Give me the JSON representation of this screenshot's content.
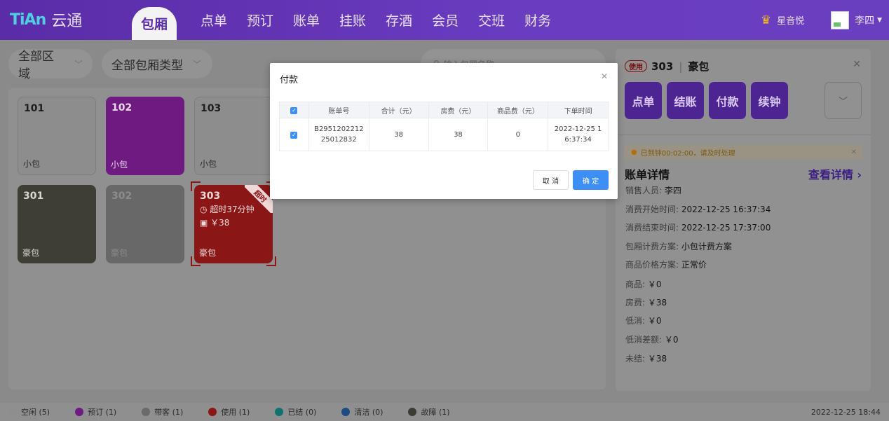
{
  "header": {
    "logo_mark": "TiAn",
    "logo_text": "云通",
    "nav": [
      "包厢",
      "点单",
      "预订",
      "账单",
      "挂账",
      "存酒",
      "会员",
      "交班",
      "财务"
    ],
    "store_name": "星音悦",
    "user_name": "李四"
  },
  "filters": {
    "area": "全部区域",
    "room_type": "全部包厢类型",
    "search_placeholder": "输入包厢名称"
  },
  "rooms": [
    {
      "num": "101",
      "type": "小包",
      "status": "idle"
    },
    {
      "num": "102",
      "type": "小包",
      "status": "reserved"
    },
    {
      "num": "103",
      "type": "小包",
      "status": "idle"
    },
    {
      "num": "301",
      "type": "豪包",
      "status": "fault"
    },
    {
      "num": "302",
      "type": "豪包",
      "status": "cleaning"
    },
    {
      "num": "303",
      "type": "豪包",
      "status": "using",
      "timeout_text": "超时37分钟",
      "amount_text": "￥38",
      "ribbon": "超时"
    }
  ],
  "detail": {
    "status": "使用",
    "room": "303",
    "room_type": "豪包",
    "actions": [
      "点单",
      "结账",
      "付款",
      "续钟"
    ],
    "warning": "已到钟00:02:00，请及时处理",
    "bill_title": "账单详情",
    "view_detail": "查看详情",
    "rows": [
      {
        "k": "销售人员:",
        "v": "李四"
      },
      {
        "k": "消费开始时间:",
        "v": "2022-12-25 16:37:34"
      },
      {
        "k": "消费结束时间:",
        "v": "2022-12-25 17:37:00"
      },
      {
        "k": "包厢计费方案:",
        "v": "小包计费方案"
      },
      {
        "k": "商品价格方案:",
        "v": "正常价"
      },
      {
        "k": "商品:",
        "v": "￥0"
      },
      {
        "k": "房费:",
        "v": "￥38"
      },
      {
        "k": "低消:",
        "v": "￥0"
      },
      {
        "k": "低消差额:",
        "v": "￥0"
      },
      {
        "k": "未结:",
        "v": "￥38"
      }
    ]
  },
  "legend": [
    {
      "label": "空闲 (5)",
      "color": "#8e8e8e"
    },
    {
      "label": "预订 (1)",
      "color": "#6e1a80"
    },
    {
      "label": "带客 (1)",
      "color": "#6a6a6a"
    },
    {
      "label": "使用 (1)",
      "color": "#8a1616"
    },
    {
      "label": "已结 (0)",
      "color": "#127070"
    },
    {
      "label": "清洁 (0)",
      "color": "#1c4c80"
    },
    {
      "label": "故障 (1)",
      "color": "#3c3c34"
    }
  ],
  "clock": "2022-12-25 18:44",
  "modal": {
    "title": "付款",
    "columns": [
      "账单号",
      "合计（元）",
      "房费（元）",
      "商品费（元）",
      "下单时间"
    ],
    "rows": [
      {
        "bill_no": "B295120221225012832",
        "total": "38",
        "room_fee": "38",
        "goods_fee": "0",
        "time": "2022-12-25 16:37:34"
      }
    ],
    "cancel": "取 消",
    "ok": "确 定"
  }
}
